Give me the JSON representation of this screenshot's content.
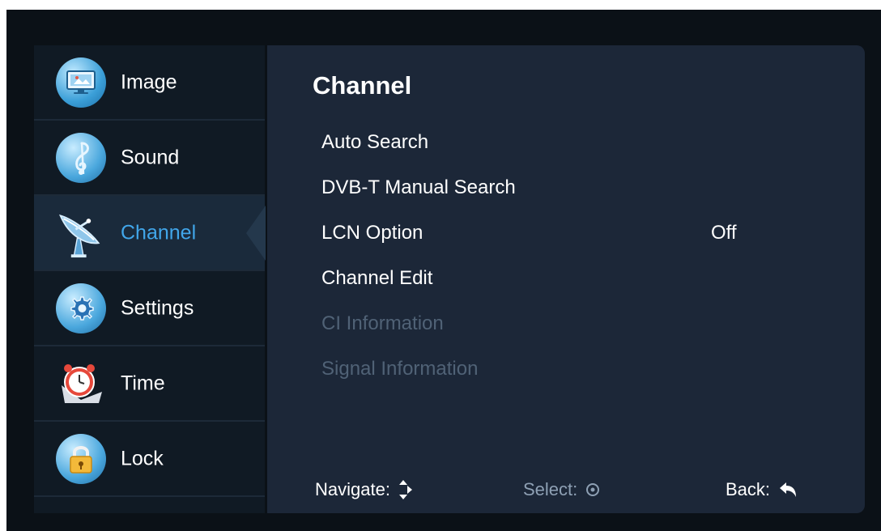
{
  "sidebar": {
    "items": [
      {
        "label": "Image",
        "icon": "monitor-icon",
        "active": false
      },
      {
        "label": "Sound",
        "icon": "music-note-icon",
        "active": false
      },
      {
        "label": "Channel",
        "icon": "satellite-dish-icon",
        "active": true
      },
      {
        "label": "Settings",
        "icon": "gear-icon",
        "active": false
      },
      {
        "label": "Time",
        "icon": "alarm-clock-icon",
        "active": false
      },
      {
        "label": "Lock",
        "icon": "padlock-icon",
        "active": false
      }
    ]
  },
  "panel": {
    "title": "Channel",
    "items": [
      {
        "label": "Auto Search",
        "value": "",
        "enabled": true
      },
      {
        "label": "DVB-T Manual Search",
        "value": "",
        "enabled": true
      },
      {
        "label": "LCN Option",
        "value": "Off",
        "enabled": true
      },
      {
        "label": "Channel Edit",
        "value": "",
        "enabled": true
      },
      {
        "label": "CI Information",
        "value": "",
        "enabled": false
      },
      {
        "label": "Signal Information",
        "value": "",
        "enabled": false
      }
    ]
  },
  "footer": {
    "navigate_label": "Navigate:",
    "select_label": "Select:",
    "back_label": "Back:"
  },
  "colors": {
    "active_accent": "#41a6ea",
    "panel_bg": "#1c2738",
    "sidebar_bg": "#101a24",
    "disabled_text": "#506276"
  }
}
